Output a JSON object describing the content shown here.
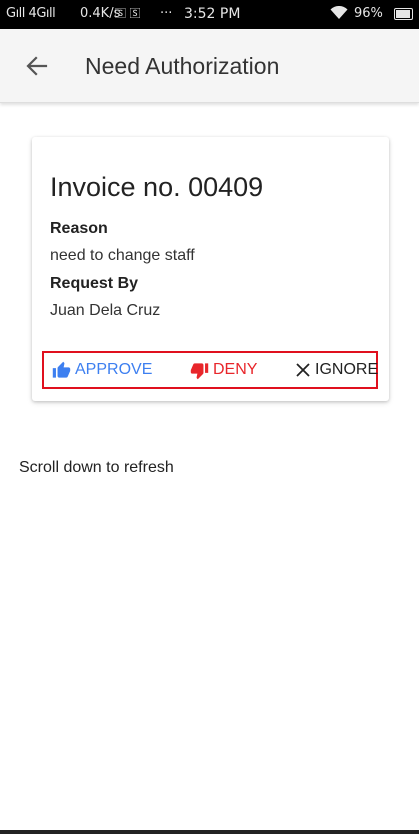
{
  "status_bar": {
    "sim": "Gıll 4Gıll",
    "speed": "0.4K/s",
    "icons": "🅂 🅂",
    "dots": "···",
    "time": "3:52 PM",
    "battery_text": "96%",
    "battery_level": 0.96
  },
  "app_bar": {
    "back_icon": "arrow-left-icon",
    "title": "Need Authorization"
  },
  "card": {
    "invoice_title": "Invoice no. 00409",
    "reason_label": "Reason",
    "reason_value": "need to change staff",
    "request_label": "Request By",
    "request_value": "Juan Dela Cruz",
    "actions": {
      "approve_label": "APPROVE",
      "deny_label": "DENY",
      "ignore_label": "IGNORE"
    }
  },
  "refresh_hint": "Scroll down to refresh",
  "colors": {
    "approve": "#3d7ff0",
    "deny": "#e8262b",
    "highlight_border": "#e0101e",
    "app_bar": "#f5f5f5"
  }
}
